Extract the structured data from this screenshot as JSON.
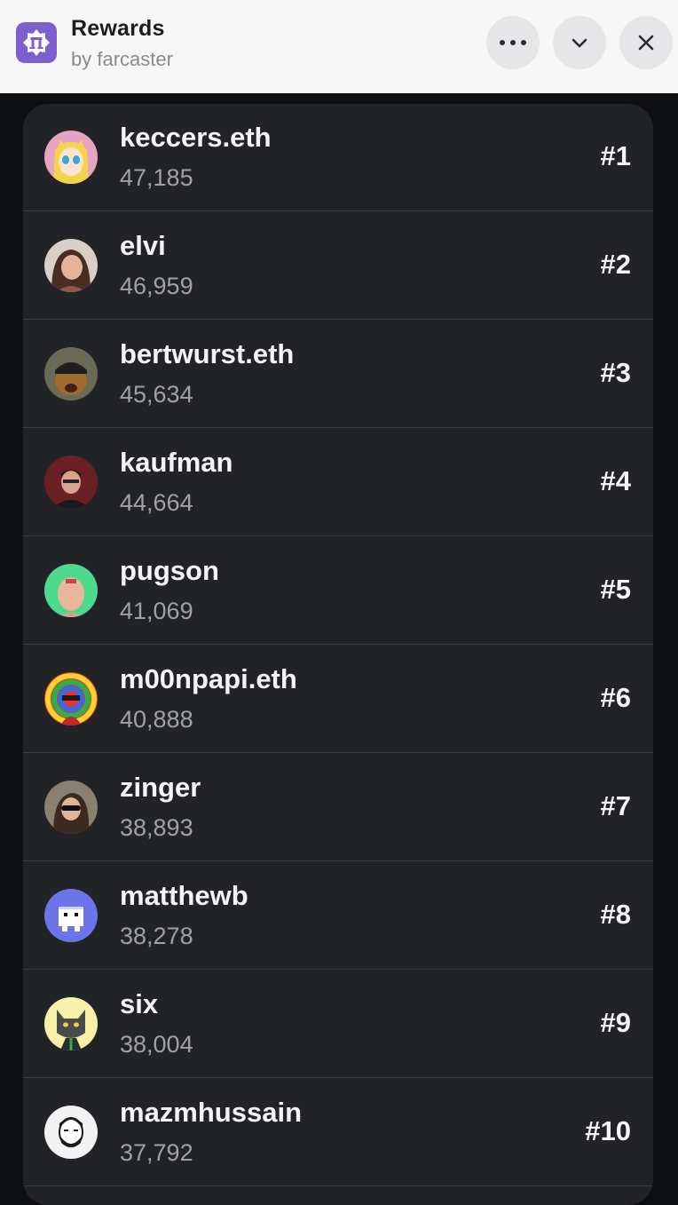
{
  "header": {
    "title": "Rewards",
    "subtitle": "by farcaster",
    "icon": "farcaster-arch-icon",
    "brand_color": "#7d5fd0",
    "buttons": [
      "more-options",
      "collapse",
      "close"
    ]
  },
  "leaderboard": {
    "rows": [
      {
        "name": "keccers.eth",
        "score": "47,185",
        "rank": "#1",
        "avatar_color": "#e7a3c4"
      },
      {
        "name": "elvi",
        "score": "46,959",
        "rank": "#2",
        "avatar_color": "#c79a85"
      },
      {
        "name": "bertwurst.eth",
        "score": "45,634",
        "rank": "#3",
        "avatar_color": "#6b6a55"
      },
      {
        "name": "kaufman",
        "score": "44,664",
        "rank": "#4",
        "avatar_color": "#6a1f24"
      },
      {
        "name": "pugson",
        "score": "41,069",
        "rank": "#5",
        "avatar_color": "#4fd98c"
      },
      {
        "name": "m00npapi.eth",
        "score": "40,888",
        "rank": "#6",
        "avatar_color": "#e8332f"
      },
      {
        "name": "zinger",
        "score": "38,893",
        "rank": "#7",
        "avatar_color": "#8a7f70"
      },
      {
        "name": "matthewb",
        "score": "38,278",
        "rank": "#8",
        "avatar_color": "#6c74e8"
      },
      {
        "name": "six",
        "score": "38,004",
        "rank": "#9",
        "avatar_color": "#f6f0a8"
      },
      {
        "name": "mazmhussain",
        "score": "37,792",
        "rank": "#10",
        "avatar_color": "#f2f2f2"
      }
    ]
  }
}
